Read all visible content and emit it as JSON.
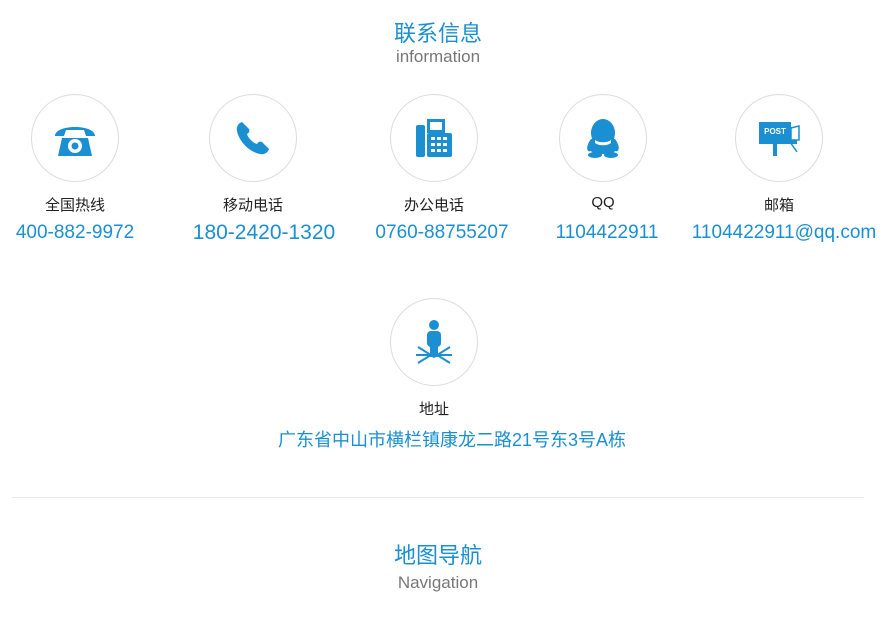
{
  "contact_section": {
    "title": "联系信息",
    "subtitle": "information"
  },
  "contacts": [
    {
      "label": "全国热线",
      "value": "400-882-9972",
      "icon": "rotary-phone-icon"
    },
    {
      "label": "移动电话",
      "value": "180-2420-1320",
      "icon": "phone-handset-icon"
    },
    {
      "label": "办公电话",
      "value": "0760-88755207",
      "icon": "fax-machine-icon"
    },
    {
      "label": "QQ",
      "value": "1104422911",
      "icon": "qq-penguin-icon"
    },
    {
      "label": "邮箱",
      "value": "1104422911@qq.com",
      "icon": "post-mailbox-icon",
      "icon_text": "POST"
    }
  ],
  "address": {
    "label": "地址",
    "value": "广东省中山市横栏镇康龙二路21号东3号A栋",
    "icon": "location-person-icon"
  },
  "navigation_section": {
    "title": "地图导航",
    "subtitle": "Navigation"
  },
  "colors": {
    "accent": "#1a8fd1",
    "label": "#222222",
    "subtitle": "#777777",
    "circle_border": "#dcdcdc"
  }
}
